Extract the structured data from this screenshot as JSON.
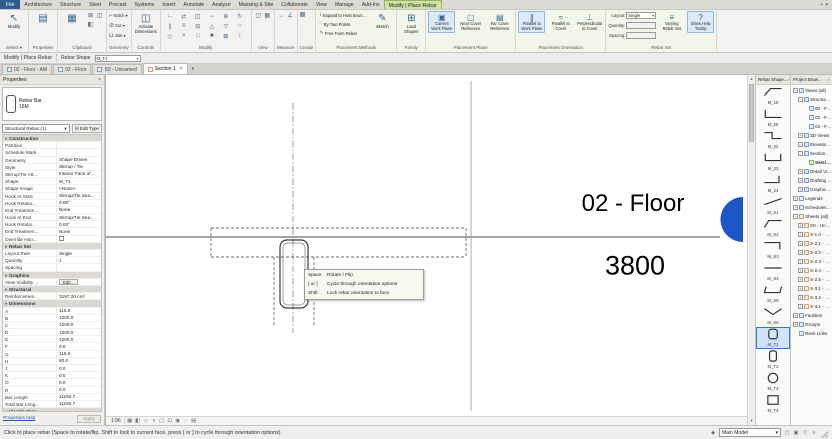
{
  "ribbon": {
    "tabs": [
      {
        "label": "File",
        "kind": "file"
      },
      {
        "label": "Architecture"
      },
      {
        "label": "Structure"
      },
      {
        "label": "Steel"
      },
      {
        "label": "Precast"
      },
      {
        "label": "Systems"
      },
      {
        "label": "Insert"
      },
      {
        "label": "Annotate"
      },
      {
        "label": "Analyze"
      },
      {
        "label": "Massing & Site"
      },
      {
        "label": "Collaborate"
      },
      {
        "label": "View"
      },
      {
        "label": "Manage"
      },
      {
        "label": "Add-Ins"
      },
      {
        "label": "Modify | Place Rebar",
        "kind": "contextual"
      }
    ],
    "select": {
      "button": "Modify",
      "label": "Select ▾"
    },
    "properties": {
      "label": "Properties"
    },
    "clipboard": {
      "label": "Clipboard"
    },
    "geometry": {
      "label": "Geometry",
      "b1": "Notch ▾",
      "b2": "Cut ▾",
      "b3": "Join ▾"
    },
    "controls": {
      "label": "Controls",
      "button": "Activate Dimensions"
    },
    "modify_panel": {
      "label": "Modify",
      "icons": [
        {
          "name": "align",
          "glyph": "∟"
        },
        {
          "name": "offset",
          "glyph": "⇄"
        },
        {
          "name": "mirror",
          "glyph": "◫"
        },
        {
          "name": "move",
          "glyph": "↔"
        },
        {
          "name": "copy",
          "glyph": "⊕"
        },
        {
          "name": "rotate",
          "glyph": "↻"
        },
        {
          "name": "trim",
          "glyph": "∥"
        },
        {
          "name": "extend",
          "glyph": "≡"
        },
        {
          "name": "split",
          "glyph": "⊟"
        },
        {
          "name": "array",
          "glyph": "△"
        },
        {
          "name": "scale",
          "glyph": "▽"
        },
        {
          "name": "pin",
          "glyph": "○"
        },
        {
          "name": "unpin",
          "glyph": "◇"
        },
        {
          "name": "delete",
          "glyph": "×"
        },
        {
          "name": "match-type",
          "glyph": "□"
        },
        {
          "name": "paint",
          "glyph": "■"
        },
        {
          "name": "join-geometry",
          "glyph": "⊠"
        },
        {
          "name": "cope",
          "glyph": "↕"
        }
      ]
    },
    "view_panel": {
      "label": "View"
    },
    "measure": {
      "label": "Measure"
    },
    "create": {
      "label": "Create"
    },
    "placement_methods": {
      "label": "Placement Methods",
      "small1": "Expand to Host Boundary",
      "small2": "By Two Points",
      "small3": "Free Form Rebar",
      "big": "Sketch"
    },
    "family": {
      "label": "Family",
      "big": "Load Shapes"
    },
    "placement_plane": {
      "label": "Placement Plane",
      "b1": "Current Work Plane",
      "b2": "Near Cover Reference",
      "b3": "Far Cover Reference"
    },
    "placement_orientation": {
      "label": "Placement Orientation",
      "b1": "Parallel to Work Plane",
      "b2": "Parallel to Cover",
      "b3": "Perpendicular to Cover"
    },
    "rebar_set": {
      "label": "Rebar Set",
      "layout_label": "Layout:",
      "layout_value": "Single",
      "quantity_label": "Quantity:",
      "spacing_label": "Spacing:",
      "varying": "Varying Rebar Set",
      "help_toggle": "Show Help Tooltip"
    }
  },
  "options_bar": {
    "mode": "Modify | Place Rebar",
    "shape_label": "Rebar Shape",
    "shape_value": "M_T1"
  },
  "view_tabs": [
    {
      "label": "02 - Floor - AM",
      "icon": "plan"
    },
    {
      "label": "02 - Floor",
      "icon": "plan"
    },
    {
      "label": "S0 - Unnamed",
      "icon": "plan"
    },
    {
      "label": "Section 1",
      "icon": "section",
      "active": true
    }
  ],
  "properties_palette": {
    "title": "Properties",
    "preview_line1": "Rebar Bar",
    "preview_line2": "16M",
    "type_selector": "Structural Rebar (1)",
    "edit_type": "Edit Type",
    "rows": [
      {
        "kind": "group",
        "label": "Construction"
      },
      {
        "kind": "row",
        "label": "Partition",
        "value": ""
      },
      {
        "kind": "row",
        "label": "Schedule Mark",
        "value": ""
      },
      {
        "kind": "row",
        "label": "Geometry",
        "value": "Shape Driven"
      },
      {
        "kind": "row",
        "label": "Style",
        "value": "Stirrup / Tie"
      },
      {
        "kind": "row",
        "label": "Stirrup/Tie Att...",
        "value": "Interior Face of..."
      },
      {
        "kind": "row",
        "label": "Shape",
        "value": "M_T1"
      },
      {
        "kind": "row",
        "label": "Shape Image",
        "value": "<None>"
      },
      {
        "kind": "row",
        "label": "Hook At Start",
        "value": "Stirrup/Tie Sea..."
      },
      {
        "kind": "row",
        "label": "Hook Rotatio...",
        "value": "0.00°"
      },
      {
        "kind": "row",
        "label": "End Treatmen...",
        "value": "None"
      },
      {
        "kind": "row",
        "label": "Hook At End",
        "value": "Stirrup/Tie Sea..."
      },
      {
        "kind": "row",
        "label": "Hook Rotatio...",
        "value": "0.00°"
      },
      {
        "kind": "row",
        "label": "End Treatmen...",
        "value": "None"
      },
      {
        "kind": "row",
        "label": "Override Hoo...",
        "value": "",
        "checkbox": true
      },
      {
        "kind": "group",
        "label": "Rebar Set"
      },
      {
        "kind": "row",
        "label": "Layout Rule",
        "value": "Single"
      },
      {
        "kind": "row",
        "label": "Quantity",
        "value": "1"
      },
      {
        "kind": "row",
        "label": "Spacing",
        "value": ""
      },
      {
        "kind": "group",
        "label": "Graphics"
      },
      {
        "kind": "row",
        "label": "View Visibility ...",
        "value": "Edit...",
        "button": true
      },
      {
        "kind": "group",
        "label": "Structural"
      },
      {
        "kind": "row",
        "label": "Reinforcemen...",
        "value": "3197.20 cm³"
      },
      {
        "kind": "group",
        "label": "Dimensions"
      },
      {
        "kind": "row",
        "label": "A",
        "value": "115.0"
      },
      {
        "kind": "row",
        "label": "B",
        "value": "1200.0"
      },
      {
        "kind": "row",
        "label": "C",
        "value": "1200.0"
      },
      {
        "kind": "row",
        "label": "D",
        "value": "1200.0"
      },
      {
        "kind": "row",
        "label": "E",
        "value": "1200.0"
      },
      {
        "kind": "row",
        "label": "F",
        "value": "0.0"
      },
      {
        "kind": "row",
        "label": "G",
        "value": "115.0"
      },
      {
        "kind": "row",
        "label": "H",
        "value": "80.0"
      },
      {
        "kind": "row",
        "label": "J",
        "value": "0.0"
      },
      {
        "kind": "row",
        "label": "K",
        "value": "0.0"
      },
      {
        "kind": "row",
        "label": "O",
        "value": "0.0"
      },
      {
        "kind": "row",
        "label": "R",
        "value": "0.0"
      },
      {
        "kind": "row",
        "label": "Bar Length",
        "value": "11150.7"
      },
      {
        "kind": "row",
        "label": "Total Bar Leng...",
        "value": "11150.7"
      },
      {
        "kind": "group",
        "label": "Identity Data"
      }
    ],
    "help_link": "Properties help",
    "apply_button": "Apply"
  },
  "canvas": {
    "level_name": "02 - Floor",
    "level_elevation": "3800",
    "tooltip": [
      {
        "key": "Space",
        "desc": "Rotate / Flip"
      },
      {
        "key": "[ or ]",
        "desc": "Cycle through orientation options"
      },
      {
        "key": "Shift",
        "desc": "Lock rebar orientation to face"
      }
    ],
    "view_scale": "1:96",
    "view_control_icons": [
      {
        "name": "detail-level",
        "glyph": "▦"
      },
      {
        "name": "visual-style",
        "glyph": "◧"
      },
      {
        "name": "sun-path",
        "glyph": "☼"
      },
      {
        "name": "shadows",
        "glyph": "◑"
      },
      {
        "name": "crop-view",
        "glyph": "▢"
      },
      {
        "name": "show-crop-region",
        "glyph": "⊡"
      },
      {
        "name": "temporary-hide-isolate",
        "glyph": "◉"
      },
      {
        "name": "reveal-hidden-elements",
        "glyph": "◌"
      },
      {
        "name": "temporary-view-properties",
        "glyph": "▤"
      }
    ]
  },
  "shape_browser": {
    "title": "Rebar Shape...",
    "items": [
      {
        "label": "M_19",
        "glyph": "bend1"
      },
      {
        "label": "M_20",
        "glyph": "l"
      },
      {
        "label": "M_22",
        "glyph": "z"
      },
      {
        "label": "M_23",
        "glyph": "u"
      },
      {
        "label": "M_24",
        "glyph": "l2"
      },
      {
        "label": "M_S1",
        "glyph": "diag"
      },
      {
        "label": "M_S2",
        "glyph": "bend2"
      },
      {
        "label": "M_S3",
        "glyph": "l3"
      },
      {
        "label": "M_S4",
        "glyph": "hline"
      },
      {
        "label": "M_S5",
        "glyph": "trap"
      },
      {
        "label": "M_S6",
        "glyph": "v"
      },
      {
        "label": "M_T1",
        "glyph": "stirrup",
        "selected": true
      },
      {
        "label": "M_T2",
        "glyph": "stirrup2"
      },
      {
        "label": "M_T3",
        "glyph": "circle"
      },
      {
        "label": "M_T4",
        "glyph": "rect"
      }
    ]
  },
  "project_browser": {
    "title": "Project Brow...",
    "items": [
      {
        "indent": 0,
        "expand": "minus",
        "icon": "folder",
        "label": "Views (all)"
      },
      {
        "indent": 1,
        "expand": "minus",
        "icon": "folder",
        "label": "Structural P..."
      },
      {
        "indent": 2,
        "expand": "none",
        "icon": "plan",
        "label": "00 - Found..."
      },
      {
        "indent": 2,
        "expand": "none",
        "icon": "plan",
        "label": "02 - Floor"
      },
      {
        "indent": 2,
        "expand": "none",
        "icon": "plan",
        "label": "03 - Floor"
      },
      {
        "indent": 1,
        "expand": "plus",
        "icon": "folder",
        "label": "3D Views"
      },
      {
        "indent": 1,
        "expand": "minus",
        "icon": "folder",
        "label": "Elevations (..."
      },
      {
        "indent": 1,
        "expand": "minus",
        "icon": "folder",
        "label": "Sections (B..."
      },
      {
        "indent": 2,
        "expand": "none",
        "icon": "section",
        "label": "Section 1",
        "bold": true
      },
      {
        "indent": 1,
        "expand": "plus",
        "icon": "folder",
        "label": "Detail Views"
      },
      {
        "indent": 1,
        "expand": "plus",
        "icon": "folder",
        "label": "Drafting Vie..."
      },
      {
        "indent": 1,
        "expand": "plus",
        "icon": "folder",
        "label": "Graphical C..."
      },
      {
        "indent": 0,
        "expand": "plus",
        "icon": "folder",
        "label": "Legends"
      },
      {
        "indent": 0,
        "expand": "plus",
        "icon": "folder",
        "label": "Schedules/Q..."
      },
      {
        "indent": 0,
        "expand": "minus",
        "icon": "sheets",
        "label": "Sheets (all)"
      },
      {
        "indent": 1,
        "expand": "plus",
        "icon": "sheet",
        "label": "S0 - Unnam..."
      },
      {
        "indent": 1,
        "expand": "plus",
        "icon": "sheet",
        "label": "S-1.0 - Site..."
      },
      {
        "indent": 1,
        "expand": "plus",
        "icon": "sheet",
        "label": "S-2.1 - Fou..."
      },
      {
        "indent": 1,
        "expand": "plus",
        "icon": "sheet",
        "label": "S-2.2 - Fra..."
      },
      {
        "indent": 1,
        "expand": "plus",
        "icon": "sheet",
        "label": "S-2.3 - Fra..."
      },
      {
        "indent": 1,
        "expand": "plus",
        "icon": "sheet",
        "label": "S-2.4 - Fra..."
      },
      {
        "indent": 1,
        "expand": "plus",
        "icon": "sheet",
        "label": "S-2.5 - Col..."
      },
      {
        "indent": 1,
        "expand": "plus",
        "icon": "sheet",
        "label": "S-3.1 - Ele..."
      },
      {
        "indent": 1,
        "expand": "plus",
        "icon": "sheet",
        "label": "S-3.2 - Ele..."
      },
      {
        "indent": 1,
        "expand": "plus",
        "icon": "sheet",
        "label": "S-4.1 - Sec..."
      },
      {
        "indent": 0,
        "expand": "plus",
        "icon": "folder",
        "label": "Families"
      },
      {
        "indent": 0,
        "expand": "plus",
        "icon": "folder",
        "label": "Groups"
      },
      {
        "indent": 0,
        "expand": "none",
        "icon": "folder",
        "label": "Revit Links"
      }
    ]
  },
  "status_bar": {
    "hint": "Click to place rebar (Space to rotate/flip, Shift to lock to current face, press [ or ] to cycle through orientation options)",
    "design_option": "Main Model",
    "icons": [
      {
        "name": "exclude-options",
        "glyph": "▢"
      },
      {
        "name": "editable-only",
        "glyph": "▣"
      },
      {
        "name": "press-drag",
        "glyph": "▽"
      },
      {
        "name": "selection-filter",
        "glyph": "≡"
      }
    ]
  },
  "icons": {
    "close": "×",
    "dropdown": "▾",
    "pin": "▪",
    "scroll_up": "▲",
    "scroll_down": "▼",
    "modify_cursor": "↖",
    "properties_palette": "▤",
    "paste": "▦",
    "cut_small": "⊠",
    "copy_small": "◫",
    "match_small": "◧",
    "notch": "⌐",
    "cut_geo": "⊘",
    "join_geo": "⊔",
    "activate": "◫",
    "view1": "◫",
    "view2": "▦",
    "measure1": "↔",
    "measure2": "∠",
    "create1": "▩",
    "expand_host": "↕",
    "two_points": "∴",
    "free_form": "∿",
    "sketch": "✎",
    "load_shapes": "⊞",
    "plane1": "▣",
    "plane2": "▢",
    "plane3": "▤",
    "orient1": "∥",
    "orient2": "≈",
    "orient3": "⊥",
    "varying": "≡",
    "help": "?",
    "edit_type": "⊞",
    "design_options": "◆"
  },
  "colors": {
    "contextual_tab_green": "#cfe2a6",
    "selection_blue": "#2e7cd6",
    "level_head_blue": "#1d56c8"
  }
}
